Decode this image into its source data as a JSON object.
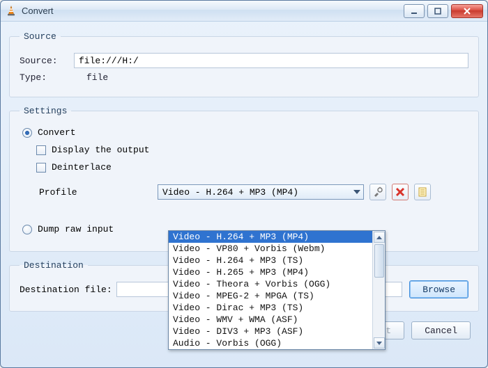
{
  "window": {
    "title": "Convert"
  },
  "source_group": {
    "legend": "Source",
    "source_label": "Source:",
    "source_value": "file:///H:/",
    "type_label": "Type:",
    "type_value": "file"
  },
  "settings_group": {
    "legend": "Settings",
    "convert_label": "Convert",
    "display_output_label": "Display the output",
    "deinterlace_label": "Deinterlace",
    "profile_label": "Profile",
    "profile_selected": "Video - H.264 + MP3 (MP4)",
    "profile_options": [
      "Video - H.264 + MP3 (MP4)",
      "Video - VP80 + Vorbis (Webm)",
      "Video - H.264 + MP3 (TS)",
      "Video - H.265 + MP3 (MP4)",
      "Video - Theora + Vorbis (OGG)",
      "Video - MPEG-2 + MPGA (TS)",
      "Video - Dirac + MP3 (TS)",
      "Video - WMV + WMA (ASF)",
      "Video - DIV3 + MP3 (ASF)",
      "Audio - Vorbis (OGG)"
    ],
    "dump_raw_label": "Dump raw input"
  },
  "destination_group": {
    "legend": "Destination",
    "dest_label": "Destination file:",
    "dest_value": "",
    "browse_label": "Browse"
  },
  "footer": {
    "start_label": "Start",
    "cancel_label": "Cancel"
  },
  "icons": {
    "tools": "tools-icon",
    "delete": "delete-icon",
    "new": "new-profile-icon"
  }
}
